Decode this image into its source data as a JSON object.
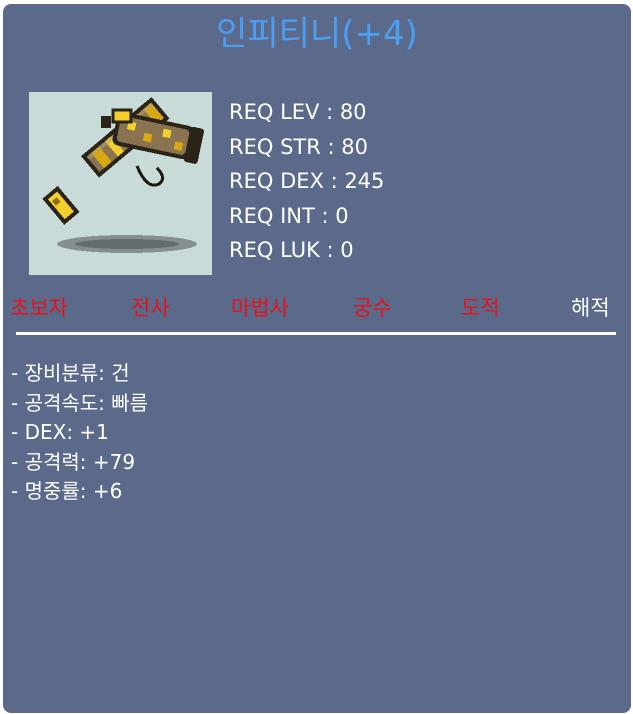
{
  "item": {
    "name": "인피티니(+4)",
    "icon": "golden-pistol-icon"
  },
  "requirements": [
    "REQ LEV : 80",
    "REQ STR : 80",
    "REQ DEX : 245",
    "REQ INT : 0",
    "REQ LUK : 0"
  ],
  "jobs": [
    {
      "label": "초보자",
      "allowed": false
    },
    {
      "label": "전사",
      "allowed": false
    },
    {
      "label": "마법사",
      "allowed": false
    },
    {
      "label": "궁수",
      "allowed": false
    },
    {
      "label": "도적",
      "allowed": false
    },
    {
      "label": "해적",
      "allowed": true
    }
  ],
  "stats": [
    "- 장비분류: 건",
    "- 공격속도: 빠름",
    "- DEX: +1",
    "- 공격력: +79",
    "- 명중률: +6"
  ],
  "colors": {
    "panel": "#5b6a8b",
    "title": "#4a9ff2",
    "job_disallowed": "#e8101a",
    "job_allowed": "#ffffff",
    "icon_background": "#c9dbd9"
  }
}
